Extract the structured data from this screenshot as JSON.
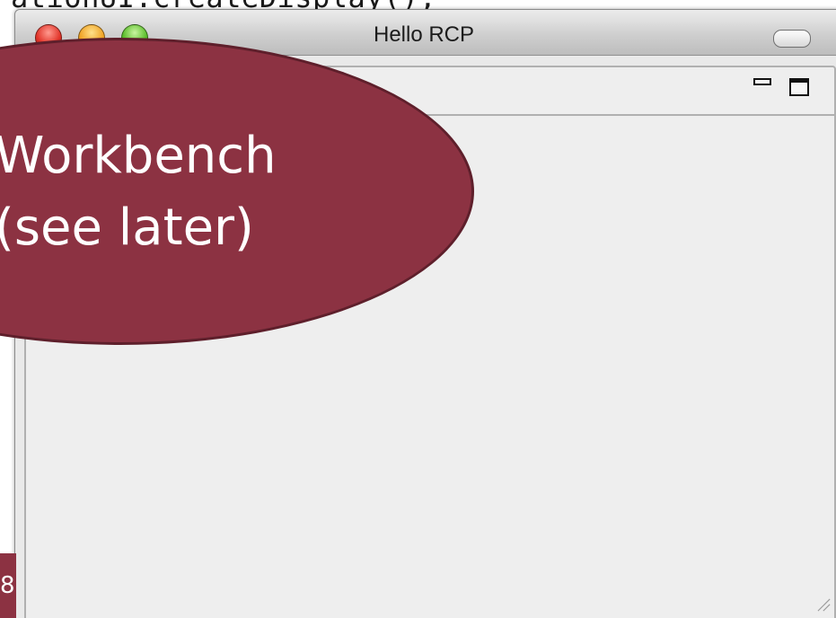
{
  "code": {
    "text": "ationUI.createDisplay();"
  },
  "window": {
    "title": "Hello RCP"
  },
  "callout": {
    "line1": "Workbench",
    "line2": "(see later)"
  },
  "slide": {
    "number": "8"
  },
  "colors": {
    "callout_fill": "#8c3242",
    "callout_text": "#ffffff",
    "window_bg": "#eeeeee"
  },
  "icons": [
    "close-button-icon",
    "minimize-button-icon",
    "zoom-button-icon",
    "toolbar-toggle-icon",
    "view-minimize-icon",
    "view-maximize-icon",
    "resize-grip-icon"
  ]
}
